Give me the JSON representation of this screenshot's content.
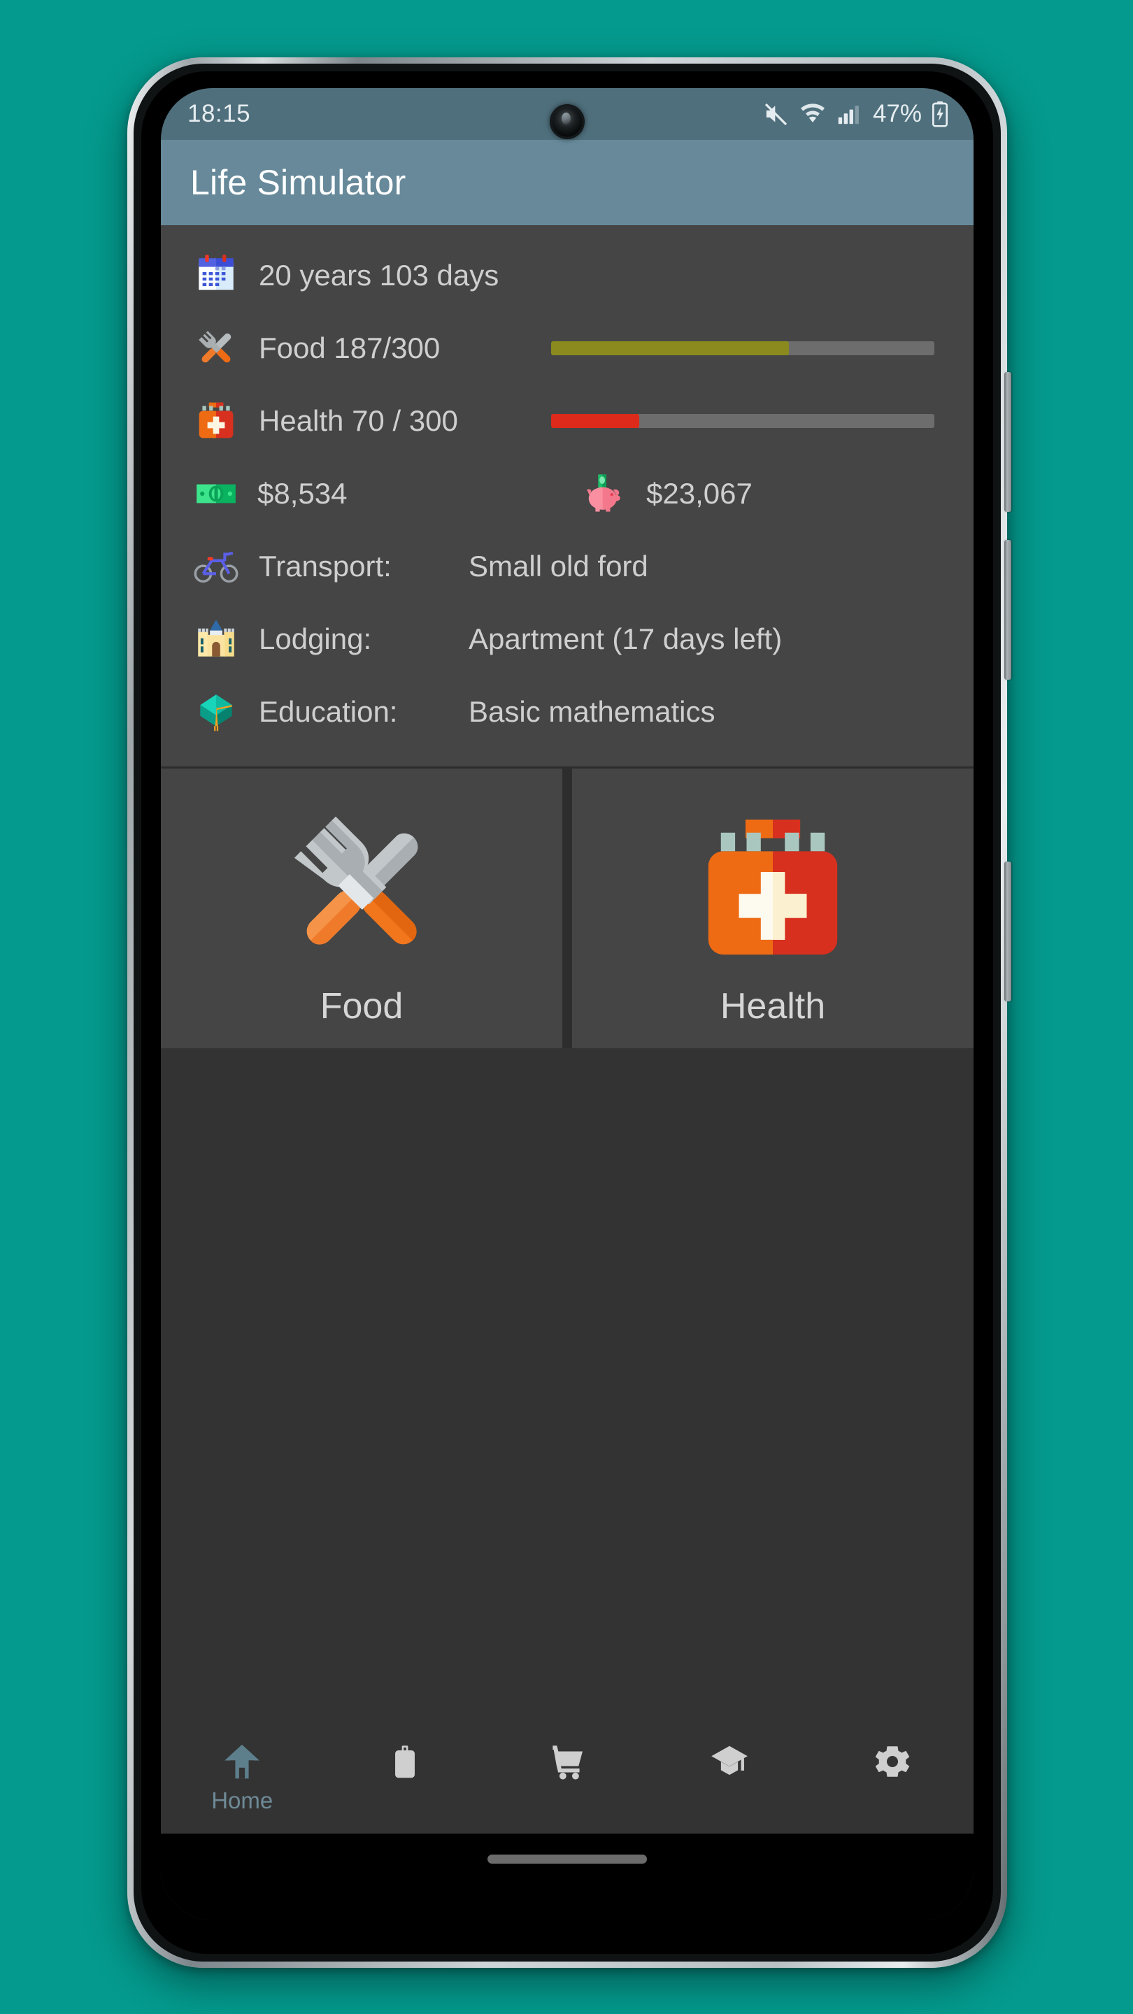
{
  "theme": {
    "page_bg": "#049a8d",
    "appbar_bg": "#67899a",
    "statusbar_bg": "#4f6f7c",
    "panel_bg": "#454545",
    "screen_bg": "#333333",
    "text_primary": "#cfcfcf",
    "accent_active": "#6e8a96",
    "food_bar_color": "#8a8a1e",
    "health_bar_color": "#dd2a1a",
    "bar_track_color": "#6d6d6d"
  },
  "status_bar": {
    "time": "18:15",
    "battery_percent": "47%",
    "icons": [
      "mute-icon",
      "wifi-icon",
      "signal-icon",
      "battery-charging-icon"
    ]
  },
  "app_bar": {
    "title": "Life Simulator"
  },
  "stats": {
    "age": {
      "icon": "calendar-icon",
      "label": "20 years 103 days"
    },
    "food": {
      "icon": "fork-knife-icon",
      "label": "Food 187/300",
      "value": 187,
      "max": 300,
      "percent": 62
    },
    "health": {
      "icon": "first-aid-kit-icon",
      "label": "Health 70 / 300",
      "value": 70,
      "max": 300,
      "percent": 23
    },
    "cash": {
      "icon": "banknote-icon",
      "amount": "$8,534"
    },
    "savings": {
      "icon": "piggy-bank-icon",
      "amount": "$23,067"
    }
  },
  "properties": [
    {
      "icon": "bicycle-icon",
      "key": "Transport:",
      "value": "Small old ford"
    },
    {
      "icon": "castle-icon",
      "key": "Lodging:",
      "value": "Apartment (17 days left)"
    },
    {
      "icon": "graduation-cap-icon",
      "key": "Education:",
      "value": "Basic mathematics"
    }
  ],
  "action_cards": [
    {
      "icon": "fork-knife-icon",
      "label": "Food"
    },
    {
      "icon": "first-aid-kit-icon",
      "label": "Health"
    }
  ],
  "bottom_nav": {
    "items": [
      {
        "icon": "home-icon",
        "label": "Home",
        "active": true
      },
      {
        "icon": "briefcase-icon",
        "label": "",
        "active": false
      },
      {
        "icon": "shopping-cart-icon",
        "label": "",
        "active": false
      },
      {
        "icon": "graduation-cap-icon",
        "label": "",
        "active": false
      },
      {
        "icon": "gear-icon",
        "label": "",
        "active": false
      }
    ]
  }
}
